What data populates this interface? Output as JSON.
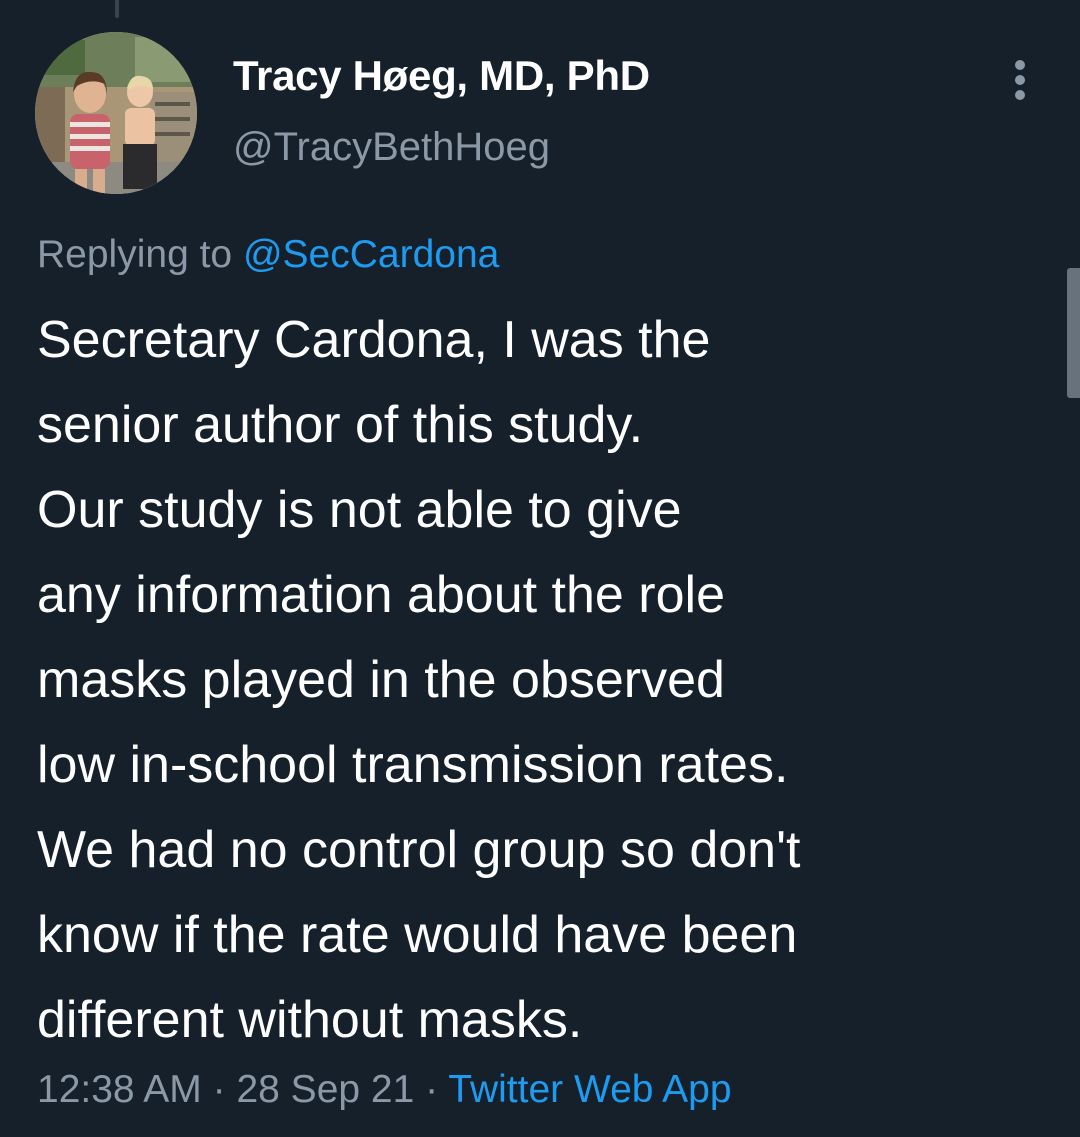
{
  "tweet": {
    "author_name": "Tracy Høeg, MD, PhD",
    "author_handle": "@TracyBethHoeg",
    "replying_prefix": "Replying to ",
    "replying_to": "@SecCardona",
    "text_lines": [
      "Secretary Cardona, I was the",
      "senior author of this study.",
      "Our study is not able to give",
      "any information about the role",
      "masks played in the observed",
      "low in-school transmission rates.",
      "We had no control group so don't",
      "know if the rate would have been",
      "different without masks."
    ],
    "time": "12:38 AM",
    "date": "28 Sep 21",
    "source": "Twitter Web App",
    "separator": "·"
  },
  "icons": {
    "more": "more-options-icon",
    "avatar": "profile-photo"
  },
  "colors": {
    "background": "#15202b",
    "text_primary": "#ffffff",
    "text_secondary": "#8b98a5",
    "accent": "#1d9bf0"
  }
}
